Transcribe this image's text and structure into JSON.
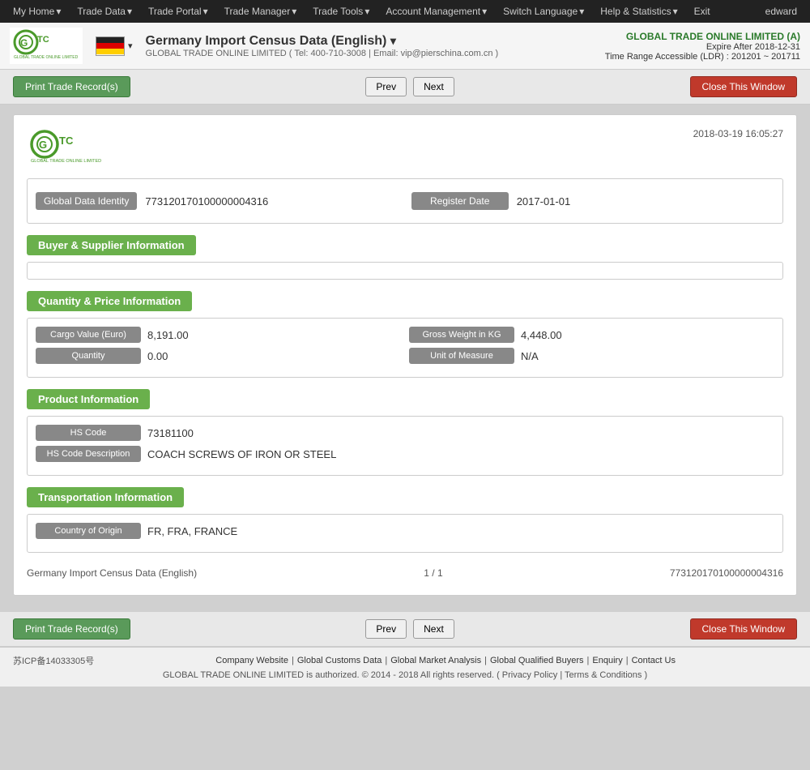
{
  "nav": {
    "items": [
      {
        "label": "My Home",
        "has_arrow": true
      },
      {
        "label": "Trade Data",
        "has_arrow": true
      },
      {
        "label": "Trade Portal",
        "has_arrow": true
      },
      {
        "label": "Trade Manager",
        "has_arrow": true
      },
      {
        "label": "Trade Tools",
        "has_arrow": true
      },
      {
        "label": "Account Management",
        "has_arrow": true
      },
      {
        "label": "Switch Language",
        "has_arrow": true
      },
      {
        "label": "Help & Statistics",
        "has_arrow": true
      },
      {
        "label": "Exit",
        "has_arrow": false
      }
    ],
    "user": "edward"
  },
  "header": {
    "title": "Germany Import Census Data (English)",
    "company_line": "GLOBAL TRADE ONLINE LIMITED ( Tel: 400-710-3008 | Email: vip@pierschina.com.cn )",
    "company_name": "GLOBAL TRADE ONLINE LIMITED (A)",
    "expire": "Expire After 2018-12-31",
    "time_range": "Time Range Accessible (LDR) : 201201 ~ 201711"
  },
  "actions": {
    "print_label": "Print Trade Record(s)",
    "prev_label": "Prev",
    "next_label": "Next",
    "close_label": "Close This Window"
  },
  "record": {
    "timestamp": "2018-03-19 16:05:27",
    "global_data_identity_label": "Global Data Identity",
    "global_data_identity_value": "773120170100000004316",
    "register_date_label": "Register Date",
    "register_date_value": "2017-01-01",
    "sections": {
      "buyer_supplier": {
        "title": "Buyer & Supplier Information",
        "content": ""
      },
      "quantity_price": {
        "title": "Quantity & Price Information",
        "fields": [
          {
            "label": "Cargo Value (Euro)",
            "value": "8,191.00"
          },
          {
            "label": "Gross Weight in KG",
            "value": "4,448.00"
          },
          {
            "label": "Quantity",
            "value": "0.00"
          },
          {
            "label": "Unit of Measure",
            "value": "N/A"
          }
        ]
      },
      "product": {
        "title": "Product Information",
        "fields": [
          {
            "label": "HS Code",
            "value": "73181100"
          },
          {
            "label": "HS Code Description",
            "value": "COACH SCREWS OF IRON OR STEEL"
          }
        ]
      },
      "transportation": {
        "title": "Transportation Information",
        "fields": [
          {
            "label": "Country of Origin",
            "value": "FR, FRA, FRANCE"
          }
        ]
      }
    },
    "footer": {
      "left": "Germany Import Census Data (English)",
      "center": "1 / 1",
      "right": "773120170100000004316"
    }
  },
  "page_footer": {
    "icp": "苏ICP备14033305号",
    "links": [
      {
        "label": "Company Website"
      },
      {
        "label": "Global Customs Data"
      },
      {
        "label": "Global Market Analysis"
      },
      {
        "label": "Global Qualified Buyers"
      },
      {
        "label": "Enquiry"
      },
      {
        "label": "Contact Us"
      }
    ],
    "copyright": "GLOBAL TRADE ONLINE LIMITED is authorized. © 2014 - 2018 All rights reserved.  (  Privacy Policy  |  Terms & Conditions  )"
  }
}
